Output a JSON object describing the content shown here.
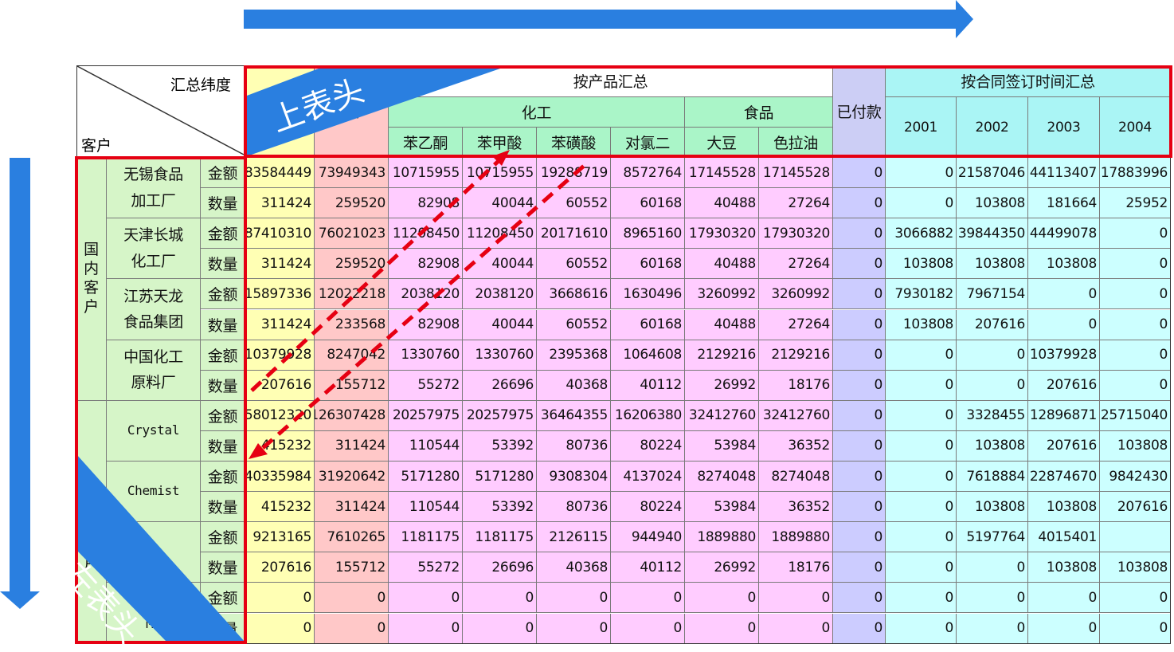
{
  "colors": {
    "border": "#7a7a7a",
    "highlight_box": "#e60012",
    "arrow_blue": "#2a7fe0",
    "dashed_arrow": "#e60012",
    "header_green": "#aaf5c8",
    "header_cyan": "#aaf5f5",
    "header_paid": "#cccef5",
    "row_label_bg": "#d6f5c8",
    "col_total_amount_bg": "#ffffb4",
    "col_total_qty_bg": "#ffc8c8",
    "product_bg": "#ffccff",
    "paid_bg": "#ccccff",
    "year_bg": "#ccffff"
  },
  "corner": {
    "top_label": "汇总纬度",
    "left_label": "客户"
  },
  "headers": {
    "product_summary": "按产品汇总",
    "chemical_group": "化工",
    "food_group": "食品",
    "paid": "已付款",
    "contract_time_summary": "按合同签订时间汇总",
    "total_qty_partial": "数",
    "products": [
      "苯乙酮",
      "苯甲酸",
      "苯磺酸",
      "对氯二",
      "大豆",
      "色拉油"
    ],
    "years": [
      "2001",
      "2002",
      "2003",
      "2004"
    ]
  },
  "groups": {
    "domestic": "国\n内\n客\n户",
    "foreign": "户"
  },
  "measures": {
    "amount": "金额",
    "quantity": "数量"
  },
  "customers": [
    {
      "name": "无锡食品\n加工厂",
      "mono": false,
      "rows": [
        [
          "83584449",
          "73949343",
          "10715955",
          "10715955",
          "19288719",
          "8572764",
          "17145528",
          "17145528",
          "0",
          "0",
          "21587046",
          "44113407",
          "17883996"
        ],
        [
          "311424",
          "259520",
          "82908",
          "40044",
          "60552",
          "60168",
          "40488",
          "27264",
          "0",
          "0",
          "103808",
          "181664",
          "25952"
        ]
      ]
    },
    {
      "name": "天津长城\n化工厂",
      "mono": false,
      "rows": [
        [
          "87410310",
          "76021023",
          "11208450",
          "11208450",
          "20171610",
          "8965160",
          "17930320",
          "17930320",
          "0",
          "3066882",
          "39844350",
          "44499078",
          "0"
        ],
        [
          "311424",
          "259520",
          "82908",
          "40044",
          "60552",
          "60168",
          "40488",
          "27264",
          "0",
          "103808",
          "103808",
          "103808",
          "0"
        ]
      ]
    },
    {
      "name": "江苏天龙\n食品集团",
      "mono": false,
      "rows": [
        [
          "15897336",
          "12022218",
          "2038120",
          "2038120",
          "3668616",
          "1630496",
          "3260992",
          "3260992",
          "0",
          "7930182",
          "7967154",
          "0",
          "0"
        ],
        [
          "311424",
          "233568",
          "82908",
          "40044",
          "60552",
          "60168",
          "40488",
          "27264",
          "0",
          "103808",
          "207616",
          "0",
          "0"
        ]
      ]
    },
    {
      "name": "中国化工\n原料厂",
      "mono": false,
      "rows": [
        [
          "10379928",
          "8247042",
          "1330760",
          "1330760",
          "2395368",
          "1064608",
          "2129216",
          "2129216",
          "0",
          "0",
          "0",
          "10379928",
          "0"
        ],
        [
          "207616",
          "155712",
          "55272",
          "26696",
          "40368",
          "40112",
          "26992",
          "18176",
          "0",
          "0",
          "0",
          "207616",
          "0"
        ]
      ]
    },
    {
      "name": "Crystal",
      "mono": true,
      "rows": [
        [
          "158012320",
          "126307428",
          "20257975",
          "20257975",
          "36464355",
          "16206380",
          "32412760",
          "32412760",
          "0",
          "0",
          "3328455",
          "12896871",
          "25715040"
        ],
        [
          "415232",
          "311424",
          "110544",
          "53392",
          "80736",
          "80224",
          "53984",
          "36352",
          "0",
          "0",
          "103808",
          "207616",
          "103808"
        ]
      ]
    },
    {
      "name": "Chemist",
      "mono": true,
      "rows": [
        [
          "40335984",
          "31920642",
          "5171280",
          "5171280",
          "9308304",
          "4137024",
          "8274048",
          "8274048",
          "0",
          "0",
          "7618884",
          "22874670",
          "9842430"
        ],
        [
          "415232",
          "311424",
          "110544",
          "53392",
          "80736",
          "80224",
          "53984",
          "36352",
          "0",
          "0",
          "103808",
          "103808",
          "207616"
        ]
      ]
    },
    {
      "name": "i",
      "mono": true,
      "rows": [
        [
          "9213165",
          "7610265",
          "1181175",
          "1181175",
          "2126115",
          "944940",
          "1889880",
          "1889880",
          "0",
          "0",
          "5197764",
          "4015401"
        ],
        [
          "207616",
          "155712",
          "55272",
          "26696",
          "40368",
          "40112",
          "26992",
          "18176",
          "0",
          "0",
          "0",
          "103808",
          "103808"
        ]
      ]
    },
    {
      "name": "Ch\nMu",
      "mono": true,
      "rows": [
        [
          "0",
          "0",
          "0",
          "0",
          "0",
          "0",
          "0",
          "0",
          "0",
          "0",
          "0",
          "0",
          "0"
        ],
        [
          "0",
          "0",
          "0",
          "0",
          "0",
          "0",
          "0",
          "0",
          "0",
          "0",
          "0",
          "0",
          "0"
        ]
      ]
    }
  ],
  "banners": {
    "top": "上表头",
    "left": "左表头"
  }
}
